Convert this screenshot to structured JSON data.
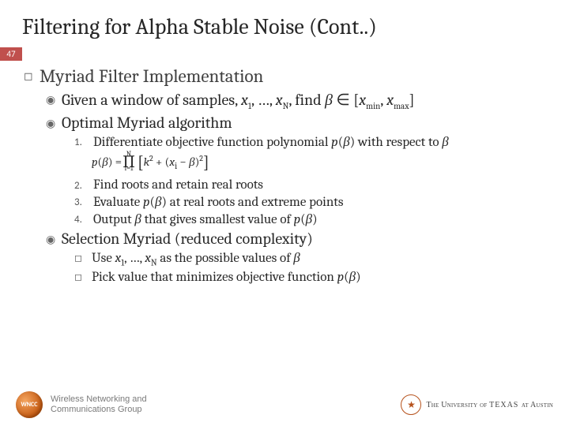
{
  "pageNumber": "47",
  "title": "Filtering for Alpha Stable Noise (Cont..)",
  "h1": "Myriad Filter Implementation",
  "b1": "Given a window of samples, x₁, …, x_N, find β ∈ [x_min, x_max]",
  "b2": "Optimal Myriad algorithm",
  "s1": "Differentiate objective function polynomial p(β) with respect to β",
  "s2": "Find roots and retain real roots",
  "s3": "Evaluate p(β) at real roots and extreme points",
  "s4": "Output β that gives smallest value of p(β)",
  "b3": "Selection Myriad (reduced complexity)",
  "c1": "Use x₁, …, x_N as the possible values of β",
  "c2": "Pick value that minimizes objective function p(β)",
  "formula": {
    "lhs": "p(β) =",
    "upper": "N",
    "lower": "i=1",
    "body_a": "k",
    "body_b": " + (x",
    "body_c": " − β)"
  },
  "footer": {
    "group": "Wireless Networking and Communications Group",
    "wncc": "WNCC",
    "ut_small": "The University of",
    "ut_big": "TEXAS",
    "ut_tail": " at Austin",
    "ut_star": "★"
  }
}
